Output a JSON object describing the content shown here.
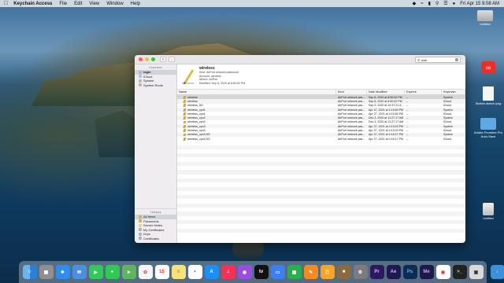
{
  "menubar": {
    "app_name": "Keychain Access",
    "items": [
      "File",
      "Edit",
      "View",
      "Window",
      "Help"
    ],
    "datetime": "Fri Apr 15  9:08 AM"
  },
  "desktop_icons": [
    {
      "label": "Untitled",
      "kind": "drive"
    },
    {
      "label": "",
      "kind": "adobe-cloud"
    },
    {
      "label": "Sketch.sketch.png",
      "kind": "file"
    },
    {
      "label": "Adobe Premiere Pro Auto-Save",
      "kind": "folder"
    },
    {
      "label": "Untitled",
      "kind": "drive"
    }
  ],
  "window": {
    "search_value": "wire",
    "sidebar": {
      "keychains_header": "Keychains",
      "keychains": [
        "login",
        "iCloud",
        "System",
        "System Roots"
      ],
      "category_header": "Category",
      "categories": [
        "All Items",
        "Passwords",
        "Secure Notes",
        "My Certificates",
        "Keys",
        "Certificates"
      ]
    },
    "detail": {
      "name": "wireless",
      "kind": "Kind: AirPort network password",
      "account": "Account: wireless",
      "where": "Where: AirPort",
      "modified": "Modified: Sep 8, 2020 at 8:50:52 PM"
    },
    "columns": [
      "Name",
      "Kind",
      "Date Modified",
      "Expires",
      "Keychain"
    ],
    "rows": [
      {
        "name": "wireless",
        "kind": "AirPort network pas...",
        "date": "Sep 8, 2020 at 8:50:52 PM",
        "expires": "--",
        "keychain": "System"
      },
      {
        "name": "wireless",
        "kind": "AirPort network pas...",
        "date": "Sep 8, 2020 at 8:50:52 PM",
        "expires": "--",
        "keychain": "iCloud"
      },
      {
        "name": "wireless_5G",
        "kind": "AirPort network pas...",
        "date": "Sep 9, 2020 at 10:37:21 A...",
        "expires": "--",
        "keychain": "iCloud"
      },
      {
        "name": "wireless_cpn1",
        "kind": "AirPort network pas...",
        "date": "Apr 27, 2021 at 4:15:50 PM",
        "expires": "--",
        "keychain": "System"
      },
      {
        "name": "wireless_cpn1",
        "kind": "AirPort network pas...",
        "date": "Apr 27, 2021 at 4:15:50 PM",
        "expires": "--",
        "keychain": "iCloud"
      },
      {
        "name": "wireless_cpn2",
        "kind": "AirPort network pas...",
        "date": "Dec 3, 2020 at 11:27:17 AM",
        "expires": "--",
        "keychain": "System"
      },
      {
        "name": "wireless_cpn2",
        "kind": "AirPort network pas...",
        "date": "Dec 3, 2020 at 11:27:17 AM",
        "expires": "--",
        "keychain": "iCloud"
      },
      {
        "name": "wireless_cpn3",
        "kind": "AirPort network pas...",
        "date": "Apr 27, 2021 at 4:13:03 PM",
        "expires": "--",
        "keychain": "System"
      },
      {
        "name": "wireless_cpn3",
        "kind": "AirPort network pas...",
        "date": "Apr 27, 2021 at 4:13:03 PM",
        "expires": "--",
        "keychain": "iCloud"
      },
      {
        "name": "wireless_cpn3-5G",
        "kind": "AirPort network pas...",
        "date": "Apr 27, 2021 at 4:16:17 PM",
        "expires": "--",
        "keychain": "System"
      },
      {
        "name": "wireless_cpn3-5G",
        "kind": "AirPort network pas...",
        "date": "Apr 27, 2021 at 4:16:17 PM",
        "expires": "--",
        "keychain": "iCloud"
      }
    ]
  },
  "dock": {
    "apps": [
      "Finder",
      "Launchpad",
      "Safari",
      "Mail",
      "FaceTime",
      "Messages",
      "Maps",
      "Photos",
      "Calendar",
      "Notes",
      "Reminders",
      "App Store",
      "Music",
      "Podcasts",
      "TV",
      "Keynote",
      "Numbers",
      "Pages",
      "Books",
      "Utility",
      "Preferences",
      "Premiere",
      "After Effects",
      "Photoshop",
      "Media Encoder",
      "Chrome",
      "Terminal",
      "Screenshot",
      "Downloads",
      "Trash"
    ],
    "colors": {
      "pr": "#2b1a5e",
      "ae": "#1f1a4d",
      "ps": "#0d2c54",
      "me": "#1d1a4a"
    },
    "labels": {
      "pr": "Pr",
      "ae": "Ae",
      "ps": "Ps",
      "me": "Me"
    }
  },
  "colors": {
    "close": "#ff5f57",
    "minimize": "#febc2e",
    "maximize": "#28c840"
  }
}
